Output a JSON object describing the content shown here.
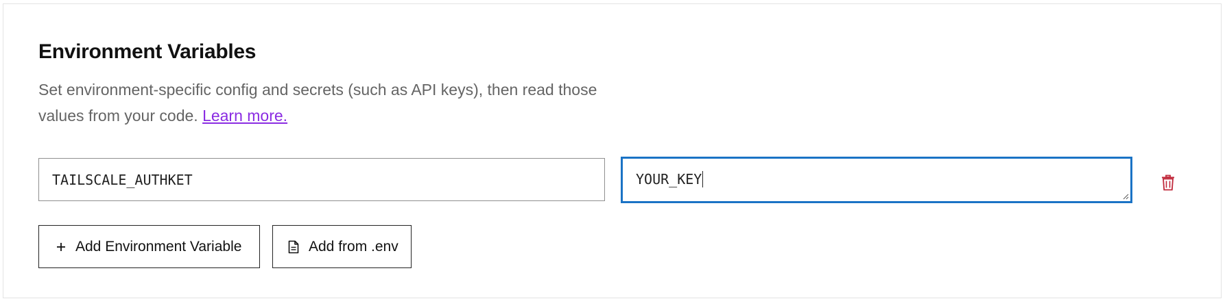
{
  "section": {
    "title": "Environment Variables",
    "description": "Set environment-specific config and secrets (such as API keys), then read those values from your code.",
    "learn_more_label": "Learn more."
  },
  "env_row": {
    "key_value": "TAILSCALE_AUTHKET",
    "value_value": "YOUR_KEY",
    "delete_icon": "trash-icon"
  },
  "actions": {
    "add_variable_label": "Add Environment Variable",
    "add_variable_icon": "plus-icon",
    "add_from_env_label": "Add from .env",
    "add_from_env_icon": "file-icon"
  },
  "colors": {
    "link": "#8a2be2",
    "focus_border": "#1a73c5",
    "delete": "#c0273a"
  }
}
